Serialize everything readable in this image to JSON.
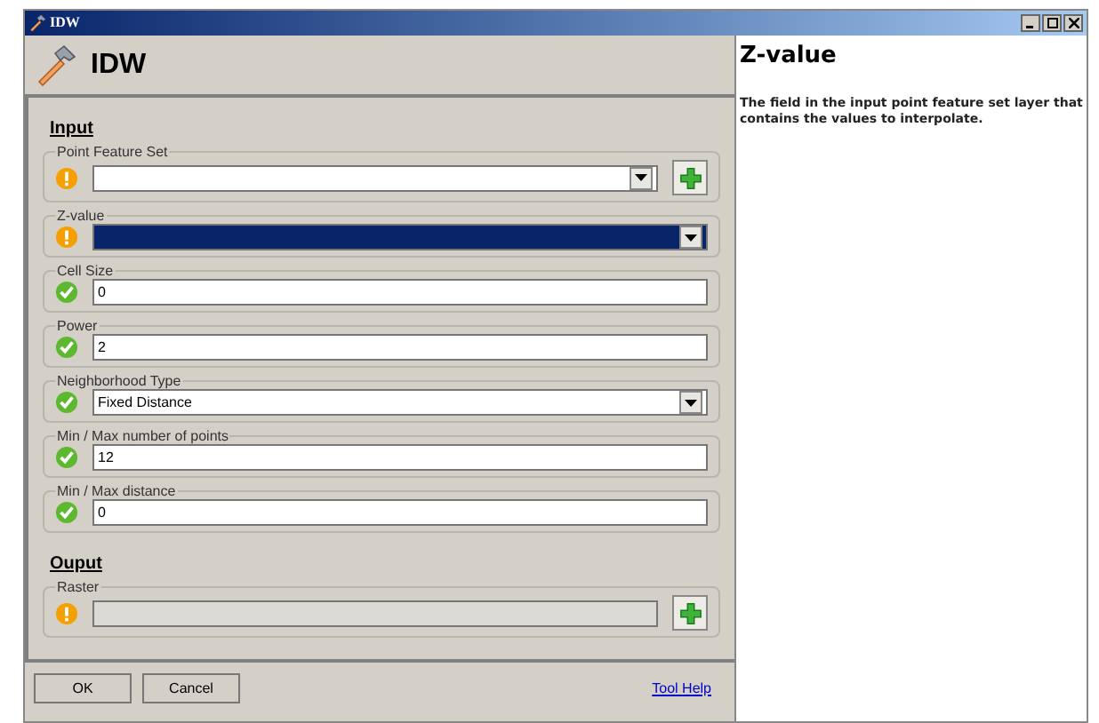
{
  "window": {
    "title": "IDW"
  },
  "header": {
    "title": "IDW"
  },
  "sections": [
    {
      "heading": "Input",
      "params": [
        {
          "label": "Point Feature Set",
          "kind": "dropdown_add",
          "valid": false,
          "selected": false,
          "disabled": false
        },
        {
          "label": "Z-value",
          "kind": "dropdown",
          "valid": false,
          "selected": true,
          "disabled": false
        },
        {
          "label": "Cell Size",
          "kind": "text",
          "valid": true,
          "value": "0",
          "selected": false,
          "disabled": false
        },
        {
          "label": "Power",
          "kind": "text",
          "valid": true,
          "value": "2",
          "selected": false,
          "disabled": false
        },
        {
          "label": "Neighborhood Type",
          "kind": "dropdown",
          "valid": true,
          "value": "Fixed Distance",
          "selected": false,
          "disabled": false
        },
        {
          "label": "Min / Max number of points",
          "kind": "text",
          "valid": true,
          "value": "12",
          "selected": false,
          "disabled": false
        },
        {
          "label": "Min / Max distance",
          "kind": "text",
          "valid": true,
          "value": "0",
          "selected": false,
          "disabled": false
        }
      ]
    },
    {
      "heading": "Ouput",
      "params": [
        {
          "label": "Raster",
          "kind": "text_add",
          "valid": false,
          "selected": false,
          "disabled": true
        }
      ]
    }
  ],
  "buttons": [
    "OK",
    "Cancel"
  ],
  "help_link": "Tool Help",
  "help": {
    "title": "Z-value",
    "text": "The field in the input point feature set layer that contains the values to interpolate."
  }
}
